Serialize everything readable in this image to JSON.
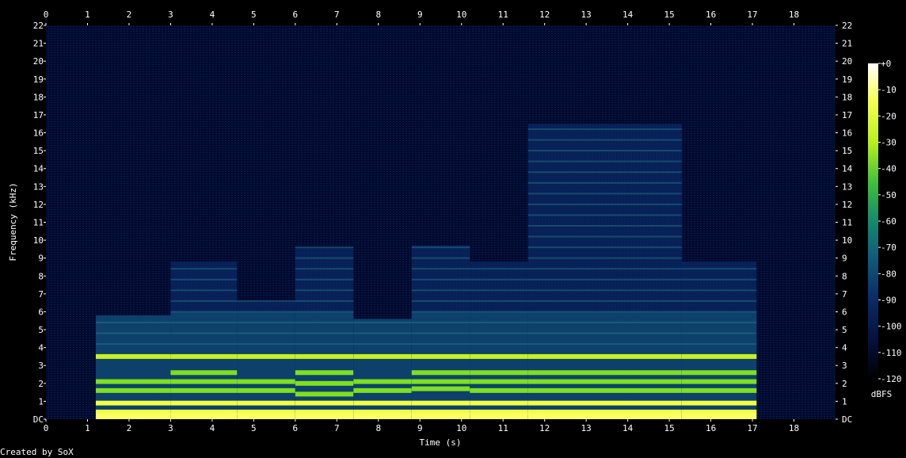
{
  "chart_data": {
    "type": "heatmap",
    "title": "",
    "xlabel": "Time (s)",
    "ylabel": "Frequency (kHz)",
    "x_ticks": [
      "0",
      "1",
      "2",
      "3",
      "4",
      "5",
      "6",
      "7",
      "8",
      "9",
      "10",
      "11",
      "12",
      "13",
      "14",
      "15",
      "16",
      "17",
      "18"
    ],
    "y_ticks": [
      "DC",
      "1",
      "2",
      "3",
      "4",
      "5",
      "6",
      "7",
      "8",
      "9",
      "10",
      "11",
      "12",
      "13",
      "14",
      "15",
      "16",
      "17",
      "18",
      "19",
      "20",
      "21",
      "22"
    ],
    "xlim": [
      0,
      19
    ],
    "ylim": [
      0,
      22
    ],
    "colorbar": {
      "label": "dBFS",
      "ticks": [
        "+0",
        "-10",
        "-20",
        "-30",
        "-40",
        "-50",
        "-60",
        "-70",
        "-80",
        "-90",
        "-100",
        "-110",
        "-120"
      ],
      "range": [
        -120,
        0
      ],
      "colors": [
        "#000000",
        "#05103c",
        "#0a2a66",
        "#0f5a7a",
        "#148a6e",
        "#3fbf3a",
        "#b8ef1e",
        "#f6ff50",
        "#ffffff"
      ]
    },
    "segments": [
      {
        "start": 1.2,
        "end": 3.0,
        "bandwidth_khz": 5.8,
        "harmonics_khz": [
          0.4,
          0.9,
          1.6,
          2.1,
          3.5
        ],
        "peak_dbfs": -15
      },
      {
        "start": 3.0,
        "end": 4.6,
        "bandwidth_khz": 8.8,
        "harmonics_khz": [
          0.4,
          0.9,
          1.6,
          2.1,
          2.6,
          3.5
        ],
        "peak_dbfs": -20
      },
      {
        "start": 4.6,
        "end": 6.0,
        "bandwidth_khz": 6.6,
        "harmonics_khz": [
          0.4,
          0.9,
          1.6,
          2.1,
          3.5
        ],
        "peak_dbfs": -18
      },
      {
        "start": 6.0,
        "end": 7.4,
        "bandwidth_khz": 9.6,
        "harmonics_khz": [
          0.4,
          0.9,
          1.4,
          2.0,
          2.6,
          3.5
        ],
        "peak_dbfs": -20
      },
      {
        "start": 7.4,
        "end": 8.8,
        "bandwidth_khz": 5.6,
        "harmonics_khz": [
          0.4,
          0.9,
          1.6,
          2.1,
          3.5
        ],
        "peak_dbfs": -30
      },
      {
        "start": 8.8,
        "end": 10.2,
        "bandwidth_khz": 9.7,
        "harmonics_khz": [
          0.4,
          0.9,
          1.7,
          2.1,
          2.6,
          3.5
        ],
        "peak_dbfs": -20
      },
      {
        "start": 10.2,
        "end": 11.6,
        "bandwidth_khz": 8.8,
        "harmonics_khz": [
          0.4,
          0.9,
          1.6,
          2.1,
          2.6,
          3.5
        ],
        "peak_dbfs": -20
      },
      {
        "start": 11.6,
        "end": 15.3,
        "bandwidth_khz": 16.5,
        "harmonics_khz": [
          0.4,
          0.9,
          1.6,
          2.1,
          2.6,
          3.5
        ],
        "peak_dbfs": -20
      },
      {
        "start": 15.3,
        "end": 17.1,
        "bandwidth_khz": 8.8,
        "harmonics_khz": [
          0.4,
          0.9,
          1.6,
          2.1,
          2.6,
          3.5
        ],
        "peak_dbfs": -20
      }
    ],
    "grid": false
  },
  "credit": "Created by SoX"
}
